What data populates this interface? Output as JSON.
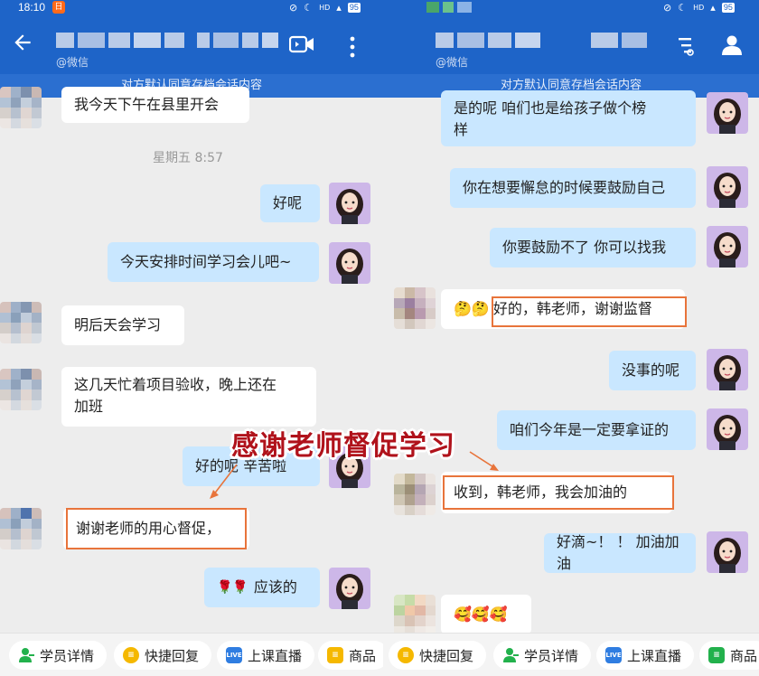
{
  "status_bar": {
    "time": "18:10",
    "badge": "日",
    "battery_left": "95",
    "battery_right": "95",
    "hd": "HD"
  },
  "header": {
    "wechat_tag": "@微信"
  },
  "banner": "对方默认同意存档会话内容",
  "left_chat": {
    "msg0": "我今天下午在县里开会",
    "timestamp": "星期五  8:57",
    "msg1": "好呢",
    "msg2": "今天安排时间学习会儿吧~",
    "msg3": "明后天会学习",
    "msg4_line1": "这几天忙着项目验收，晚上还在",
    "msg4_line2": "加班",
    "msg5": "好的呢  辛苦啦",
    "msg6": "谢谢老师的用心督促，",
    "msg7_emoji": "🌹🌹",
    "msg7_text": "应该的"
  },
  "right_chat": {
    "msg0_line1": "是的呢   咱们也是给孩子做个榜",
    "msg0_line2": "样",
    "msg1": "你在想要懈怠的时候要鼓励自己",
    "msg2": "你要鼓励不了  你可以找我",
    "msg3_emoji": "🤔🤔",
    "msg3_text": "好的，韩老师，谢谢监督",
    "msg4": "没事的呢",
    "msg5": "咱们今年是一定要拿证的",
    "msg6": "收到，韩老师，我会加油的",
    "msg7": "好滴~！ ！ 加油加油",
    "msg8_emoji": "🥰🥰🥰"
  },
  "annotation": "感谢老师督促学习",
  "toolbar_left": {
    "chip1": "学员详情",
    "chip2": "快捷回复",
    "chip3": "上课直播",
    "chip4": "商品"
  },
  "toolbar_right": {
    "chip1": "快捷回复",
    "chip2": "学员详情",
    "chip3": "上课直播",
    "chip4": "商品"
  },
  "live_icon_text": "LIVE",
  "colors": {
    "header_blue": "#1e64c8",
    "outgoing_bubble": "#c9e7ff",
    "incoming_bubble": "#ffffff",
    "highlight_orange": "#e8743b",
    "annotation_red": "#b0121b"
  },
  "icons": [
    "back-arrow-icon",
    "video-call-icon",
    "more-vert-icon",
    "sort-icon",
    "person-icon",
    "user-detail-icon",
    "quick-reply-icon",
    "live-icon",
    "goods-icon"
  ]
}
